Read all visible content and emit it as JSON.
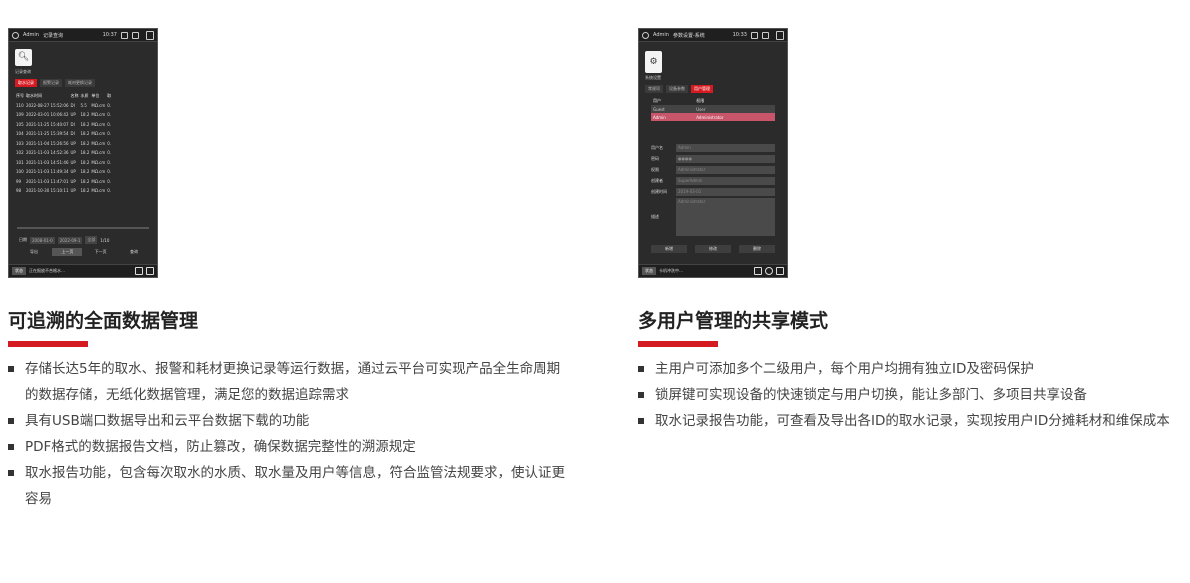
{
  "left": {
    "device": {
      "user": "Admin",
      "screen_title": "记录查询",
      "time": "10:37",
      "app_label": "记录查询",
      "tabs": [
        "取水记录",
        "报警记录",
        "耗材更换记录"
      ],
      "columns": [
        "序号",
        "取水时间",
        "名称",
        "水质",
        "单位",
        "取"
      ],
      "rows": [
        [
          "110",
          "2022-08-27 15:52:06",
          "DI",
          "5.5",
          "MΩ.cm",
          "0."
        ],
        [
          "109",
          "2022-03-01 10:06:42",
          "UP",
          "18.2",
          "MΩ.cm",
          "0."
        ],
        [
          "105",
          "2021-11-25 15:40:07",
          "DI",
          "18.2",
          "MΩ.cm",
          "0."
        ],
        [
          "104",
          "2021-11-25 15:39:54",
          "DI",
          "18.2",
          "MΩ.cm",
          "0."
        ],
        [
          "103",
          "2021-11-04 15:26:56",
          "UP",
          "18.2",
          "MΩ.cm",
          "0."
        ],
        [
          "102",
          "2021-11-03 14:52:36",
          "UP",
          "18.2",
          "MΩ.cm",
          "0."
        ],
        [
          "101",
          "2021-11-03 14:51:46",
          "UP",
          "18.2",
          "MΩ.cm",
          "0."
        ],
        [
          "100",
          "2021-11-03 11:49:34",
          "UP",
          "18.2",
          "MΩ.cm",
          "0."
        ],
        [
          "99",
          "2021-11-03 11:47:01",
          "UP",
          "18.2",
          "MΩ.cm",
          "0."
        ],
        [
          "98",
          "2021-10-30 15:10:11",
          "UP",
          "18.2",
          "MΩ.cm",
          "0."
        ]
      ],
      "filter": {
        "label": "日期",
        "from": "2008-01-0",
        "to": "2022-09-1",
        "type": "全部",
        "page": "1/10"
      },
      "buttons": [
        "导出",
        "上一页",
        "下一页",
        "查询"
      ],
      "status_tag": "状态",
      "status_msg": "正在报放不合格水…"
    },
    "heading": "可追溯的全面数据管理",
    "bullets": [
      "存储长达5年的取水、报警和耗材更换记录等运行数据，通过云平台可实现产品全生命周期的数据存储，无纸化数据管理，满足您的数据追踪需求",
      "具有USB端口数据导出和云平台数据下载的功能",
      "PDF格式的数据报告文档，防止篡改，确保数据完整性的溯源规定",
      "取水报告功能，包含每次取水的水质、取水量及用户等信息，符合监管法规要求，使认证更容易"
    ]
  },
  "right": {
    "device": {
      "user": "Admin",
      "screen_title": "参数设置-系统",
      "time": "10:33",
      "app_label": "系统设置",
      "tabs": [
        "常规项",
        "设备参数",
        "用户管理"
      ],
      "table_headers": [
        "用户",
        "权限"
      ],
      "users": [
        [
          "Guest",
          "User"
        ],
        [
          "Admin",
          "Administrator"
        ]
      ],
      "fields": [
        {
          "label": "用户名",
          "value": "Admin"
        },
        {
          "label": "密码",
          "value": "●●●●"
        },
        {
          "label": "权限",
          "value": "Administrator"
        },
        {
          "label": "创建者",
          "value": "SuperAdmin"
        },
        {
          "label": "创建时间",
          "value": "2019-03-01"
        }
      ],
      "desc_label": "描述",
      "desc_value": "Administrator",
      "buttons": [
        "新增",
        "修改",
        "删除"
      ],
      "status_tag": "状态",
      "status_msg": "卡机冲洗中…"
    },
    "heading": "多用户管理的共享模式",
    "bullets": [
      "主用户可添加多个二级用户，每个用户均拥有独立ID及密码保护",
      "锁屏键可实现设备的快速锁定与用户切换，能让多部门、多项目共享设备",
      "取水记录报告功能，可查看及导出各ID的取水记录，实现按用户ID分摊耗材和维保成本"
    ]
  },
  "colors": {
    "accent": "#d51b22",
    "device_bg": "#2b2b2b"
  }
}
